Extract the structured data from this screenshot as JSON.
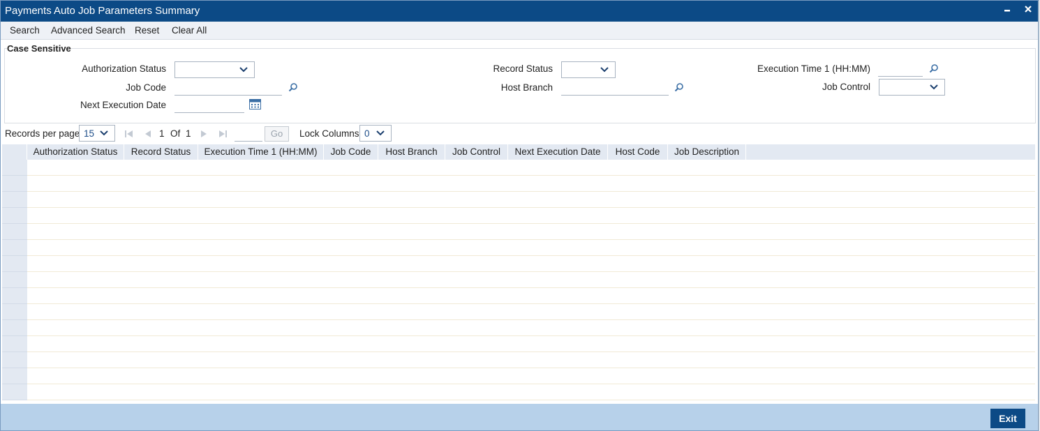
{
  "window": {
    "title": "Payments Auto Job Parameters Summary"
  },
  "toolbar": {
    "search": "Search",
    "advanced_search": "Advanced Search",
    "reset": "Reset",
    "clear_all": "Clear All"
  },
  "criteria": {
    "legend": "Case Sensitive",
    "authorization_status": {
      "label": "Authorization Status",
      "value": ""
    },
    "record_status": {
      "label": "Record Status",
      "value": ""
    },
    "execution_time_1": {
      "label": "Execution Time 1 (HH:MM)",
      "value": ""
    },
    "job_code": {
      "label": "Job Code",
      "value": ""
    },
    "host_branch": {
      "label": "Host Branch",
      "value": ""
    },
    "job_control": {
      "label": "Job Control",
      "value": ""
    },
    "next_execution_date": {
      "label": "Next Execution Date",
      "value": ""
    }
  },
  "pager": {
    "records_per_page_label": "Records per page",
    "records_per_page": "15",
    "current_page": "1",
    "of_label": "Of",
    "total_pages": "1",
    "go_label": "Go",
    "lock_columns_label": "Lock Columns",
    "lock_columns": "0"
  },
  "grid": {
    "columns": [
      "Authorization Status",
      "Record Status",
      "Execution Time 1 (HH:MM)",
      "Job Code",
      "Host Branch",
      "Job Control",
      "Next Execution Date",
      "Host Code",
      "Job Description"
    ],
    "rows": []
  },
  "footer": {
    "exit": "Exit"
  },
  "colors": {
    "titlebar": "#0c4a86",
    "menubar": "#eef1f6",
    "grid_header": "#e3e9f2",
    "footer": "#b7d1ea",
    "exit_button": "#0c4a86"
  }
}
